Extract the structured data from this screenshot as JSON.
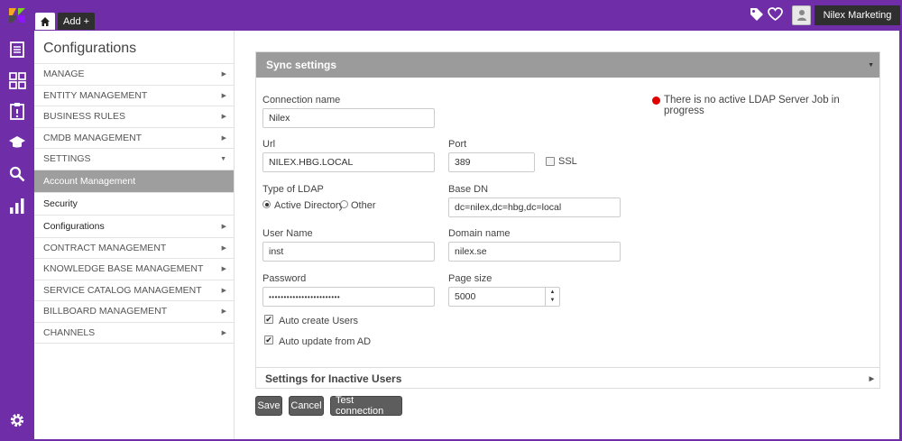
{
  "header": {
    "home_tab_icon": "home-icon",
    "add_tab_label": "Add +",
    "user_name": "Nilex Marketing"
  },
  "nav_icons": [
    "list-icon",
    "dashboard-icon",
    "clipboard-icon",
    "graduation-cap-icon",
    "search-icon",
    "bar-chart-icon",
    "settings-gear-icon"
  ],
  "sidebar": {
    "title": "Configurations",
    "items": [
      {
        "label": "MANAGE"
      },
      {
        "label": "ENTITY MANAGEMENT"
      },
      {
        "label": "BUSINESS RULES"
      },
      {
        "label": "CMDB MANAGEMENT"
      },
      {
        "label": "SETTINGS"
      },
      {
        "label": "Account Management"
      },
      {
        "label": "Security"
      },
      {
        "label": "Configurations"
      },
      {
        "label": "CONTRACT MANAGEMENT"
      },
      {
        "label": "KNOWLEDGE BASE MANAGEMENT"
      },
      {
        "label": "SERVICE CATALOG MANAGEMENT"
      },
      {
        "label": "BILLBOARD MANAGEMENT"
      },
      {
        "label": "CHANNELS"
      }
    ]
  },
  "sync": {
    "title": "Sync settings",
    "status_text": "There is no active LDAP Server Job in progress",
    "status_color": "#e00000",
    "connection_name_label": "Connection name",
    "connection_name_value": "Nilex",
    "url_label": "Url",
    "url_value": "NILEX.HBG.LOCAL",
    "port_label": "Port",
    "port_value": "389",
    "ssl_label": "SSL",
    "ldap_type_label": "Type of LDAP",
    "ldap_option_ad": "Active Directory",
    "ldap_option_other": "Other",
    "base_dn_label": "Base DN",
    "base_dn_value": "dc=nilex,dc=hbg,dc=local",
    "user_name_label": "User Name",
    "user_name_value": "inst",
    "domain_label": "Domain name",
    "domain_value": "nilex.se",
    "password_label": "Password",
    "password_value": "••••••••••••••••••••••••",
    "page_size_label": "Page size",
    "page_size_value": "5000",
    "auto_create_label": "Auto create Users",
    "auto_update_label": "Auto update from AD",
    "inactive_title": "Settings for Inactive Users"
  },
  "buttons": {
    "save": "Save",
    "cancel": "Cancel",
    "test": "Test connection"
  },
  "colors": {
    "brand_purple": "#6f2da8",
    "header_gray": "#9b9b9b",
    "button_gray": "#5d5d5d"
  }
}
